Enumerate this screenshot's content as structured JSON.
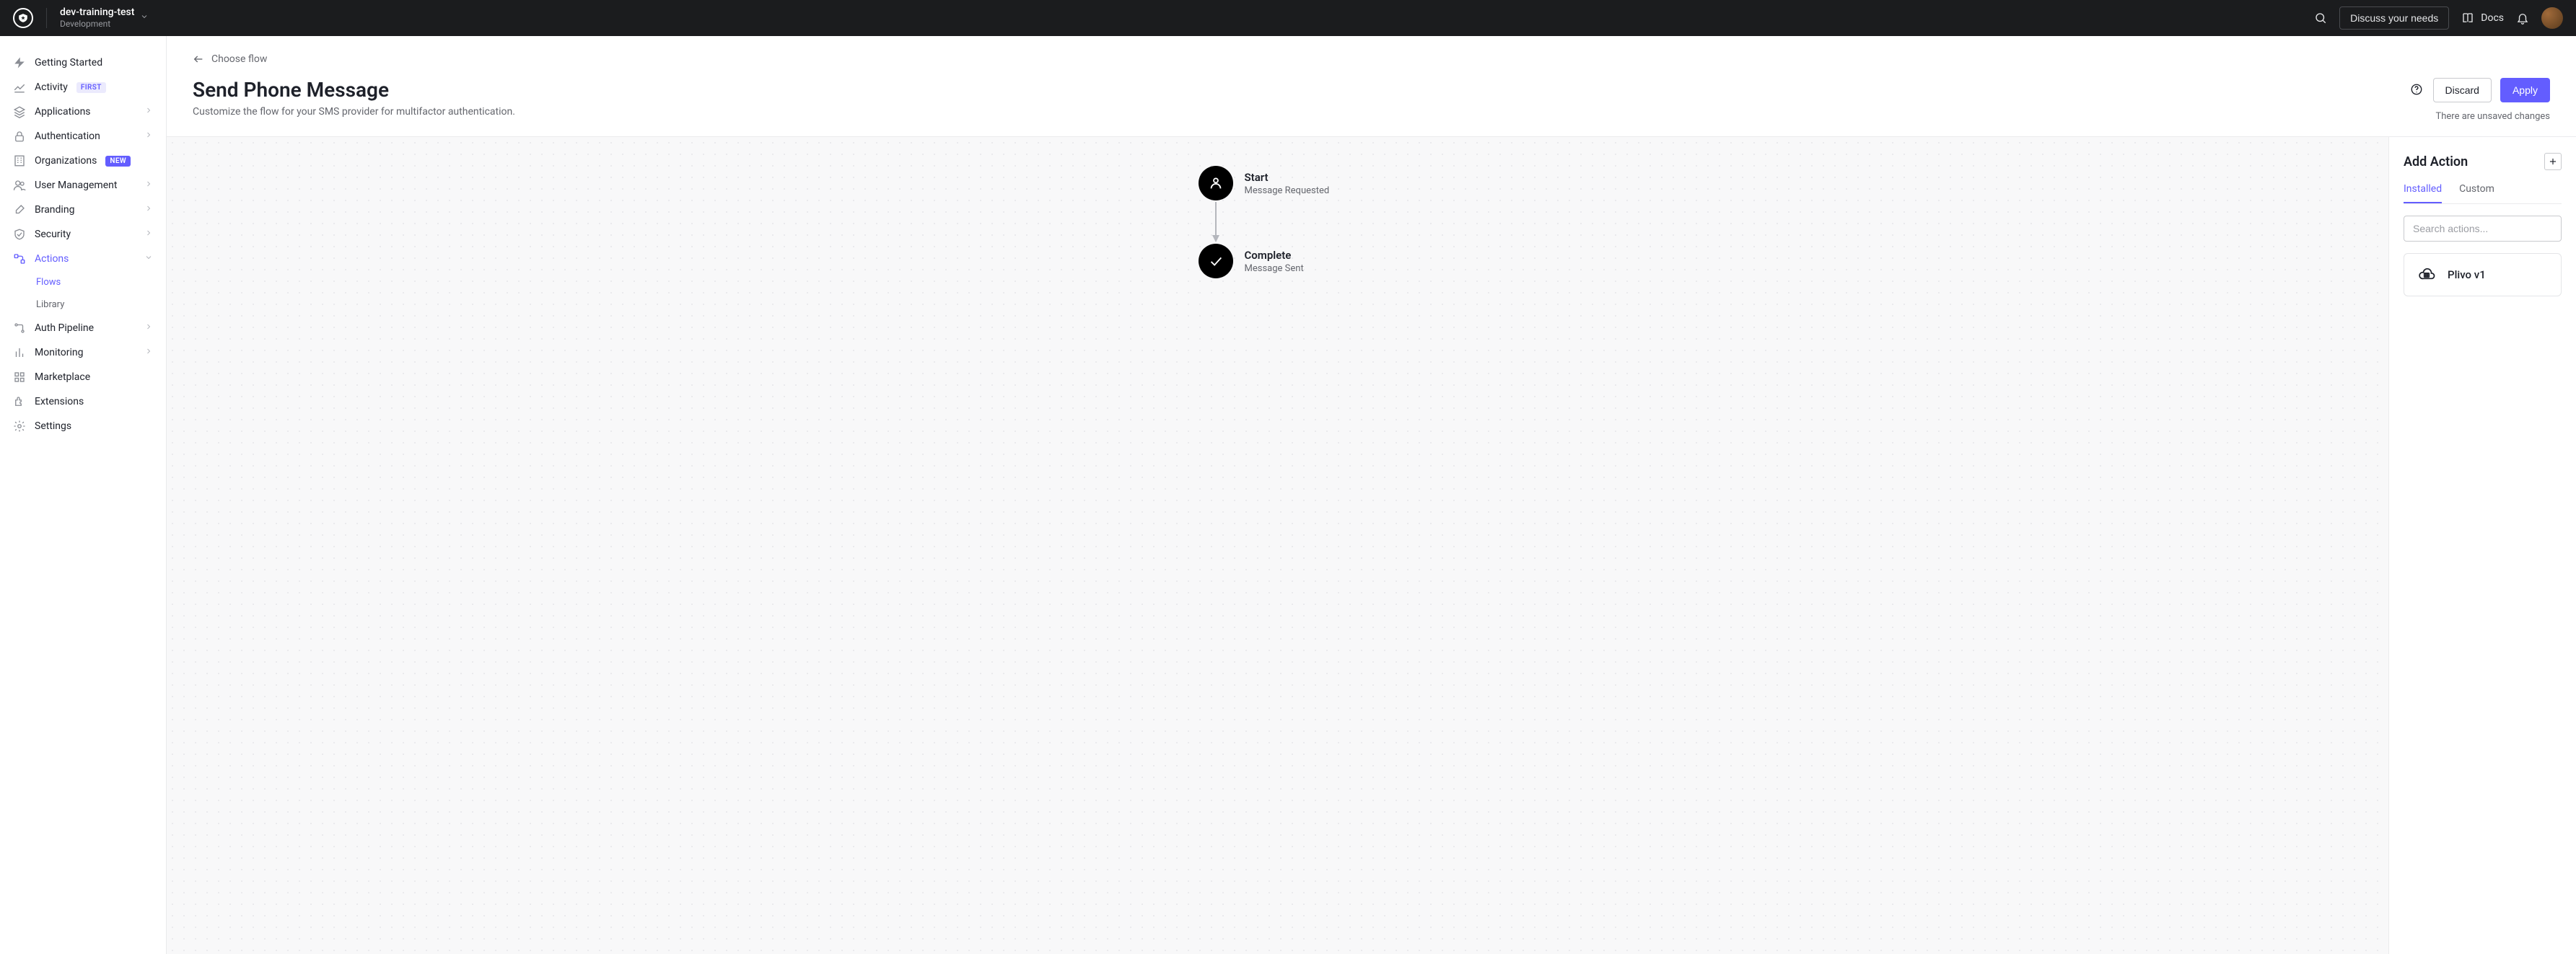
{
  "header": {
    "tenant_name": "dev-training-test",
    "tenant_env": "Development",
    "discuss_label": "Discuss your needs",
    "docs_label": "Docs"
  },
  "sidebar": {
    "items": [
      {
        "label": "Getting Started",
        "icon": "bolt",
        "expandable": false
      },
      {
        "label": "Activity",
        "icon": "chart",
        "badge": "FIRST",
        "expandable": false
      },
      {
        "label": "Applications",
        "icon": "stack",
        "expandable": true
      },
      {
        "label": "Authentication",
        "icon": "lock",
        "expandable": true
      },
      {
        "label": "Organizations",
        "icon": "building",
        "badge": "NEW",
        "expandable": false
      },
      {
        "label": "User Management",
        "icon": "users",
        "expandable": true
      },
      {
        "label": "Branding",
        "icon": "brush",
        "expandable": true
      },
      {
        "label": "Security",
        "icon": "shield",
        "expandable": true
      },
      {
        "label": "Actions",
        "icon": "flow",
        "expandable": true,
        "active": true,
        "children": [
          {
            "label": "Flows",
            "active": true
          },
          {
            "label": "Library",
            "active": false
          }
        ]
      },
      {
        "label": "Auth Pipeline",
        "icon": "pipeline",
        "expandable": true
      },
      {
        "label": "Monitoring",
        "icon": "bars",
        "expandable": true
      },
      {
        "label": "Marketplace",
        "icon": "grid",
        "expandable": false
      },
      {
        "label": "Extensions",
        "icon": "puzzle",
        "expandable": false
      },
      {
        "label": "Settings",
        "icon": "gear",
        "expandable": false
      }
    ]
  },
  "page": {
    "back_label": "Choose flow",
    "title": "Send Phone Message",
    "subtitle": "Customize the flow for your SMS provider for multifactor authentication.",
    "discard_label": "Discard",
    "apply_label": "Apply",
    "unsaved_note": "There are unsaved changes"
  },
  "flow": {
    "start": {
      "title": "Start",
      "subtitle": "Message Requested"
    },
    "complete": {
      "title": "Complete",
      "subtitle": "Message Sent"
    }
  },
  "panel": {
    "title": "Add Action",
    "tabs": {
      "installed": "Installed",
      "custom": "Custom"
    },
    "search_placeholder": "Search actions...",
    "actions": [
      {
        "title": "Plivo v1"
      }
    ]
  }
}
